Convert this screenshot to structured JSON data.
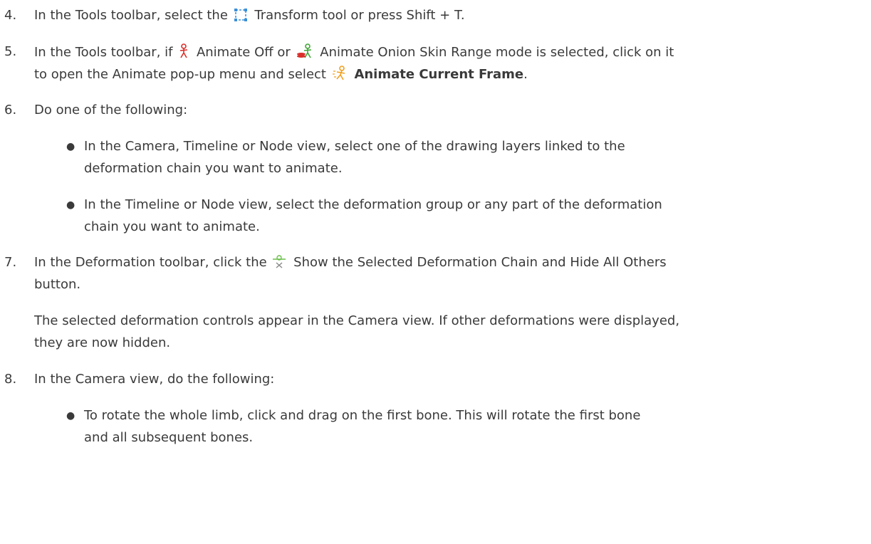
{
  "steps": {
    "s4": {
      "number": "4.",
      "text_a": "In the Tools toolbar, select the",
      "icon": "transform-tool-icon",
      "text_b": "Transform tool or press Shift + T."
    },
    "s5": {
      "number": "5.",
      "line1_a": "In the Tools toolbar, if",
      "icon1": "animate-off-icon",
      "line1_b": "Animate Off or",
      "icon2": "animate-onion-skin-range-icon",
      "line1_c": "Animate Onion Skin Range mode is selected, click on it",
      "line2_a": "to open the Animate pop-up menu and select",
      "icon3": "animate-current-frame-icon",
      "line2_bold": "Animate Current Frame",
      "line2_end": "."
    },
    "s6": {
      "number": "6.",
      "text": "Do one of the following:",
      "bullets": [
        {
          "line1": "In the Camera, Timeline or Node view, select one of the drawing layers linked to the",
          "line2": "deformation chain you want to animate."
        },
        {
          "line1": "In the Timeline or Node view, select the deformation group or any part of the deformation",
          "line2": "chain you want to animate."
        }
      ]
    },
    "s7": {
      "number": "7.",
      "line1_a": "In the Deformation toolbar, click the",
      "icon": "show-selected-deformation-chain-icon",
      "line1_b": "Show the Selected Deformation Chain and Hide All Others",
      "line2": "button.",
      "para_line1": "The selected deformation controls appear in the Camera view. If other deformations were displayed,",
      "para_line2": "they are now hidden."
    },
    "s8": {
      "number": "8.",
      "text": "In the Camera view, do the following:",
      "bullets": [
        {
          "line1": "To rotate the whole limb, click and drag on the first bone. This will rotate the first bone",
          "line2": "and all subsequent bones."
        }
      ]
    }
  },
  "colors": {
    "text": "#3a3a3a",
    "transform_icon": "#3a8fd8",
    "animate_red": "#d9302c",
    "animate_green": "#3fa535",
    "animate_orange": "#f0a020",
    "deform_green": "#6bbf4a"
  }
}
